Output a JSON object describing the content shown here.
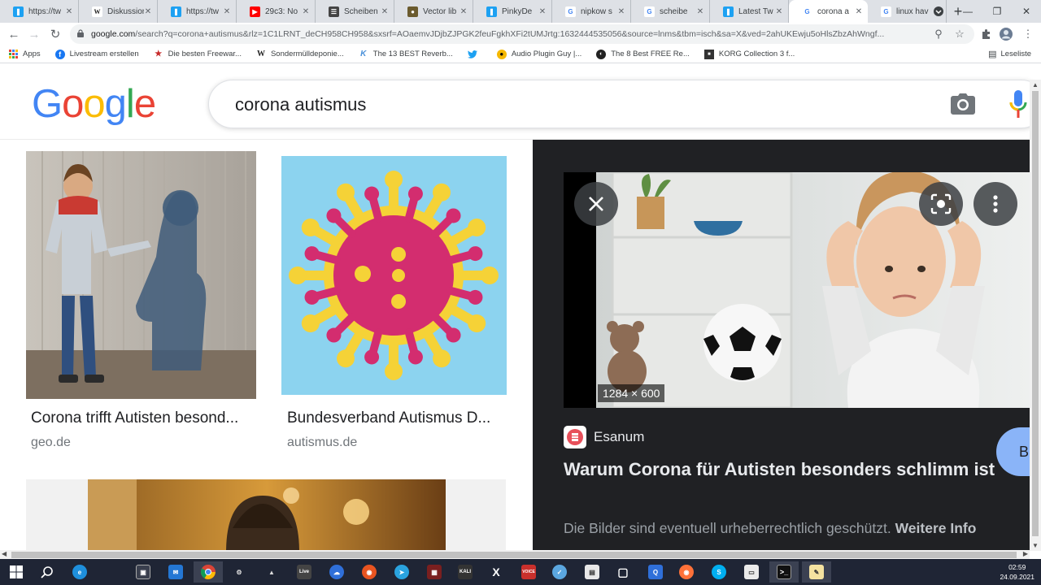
{
  "tabs": [
    {
      "title": "https://tw",
      "icon": "twitter-icon",
      "color": "#1da1f2"
    },
    {
      "title": "Diskussion",
      "icon": "wikipedia-icon",
      "color": "#ffffff"
    },
    {
      "title": "https://tw",
      "icon": "twitter-icon",
      "color": "#1da1f2"
    },
    {
      "title": "29c3: No",
      "icon": "youtube-icon",
      "color": "#ff0000"
    },
    {
      "title": "Scheiben",
      "icon": "page-icon",
      "color": "#444444"
    },
    {
      "title": "Vector lib",
      "icon": "site-icon",
      "color": "#6b5b2e"
    },
    {
      "title": "PinkyDe",
      "icon": "twitter-icon",
      "color": "#1da1f2"
    },
    {
      "title": "nipkow s",
      "icon": "google-icon",
      "color": "#4285f4"
    },
    {
      "title": "scheibe",
      "icon": "google-icon",
      "color": "#4285f4"
    },
    {
      "title": "Latest Tw",
      "icon": "twitter-icon",
      "color": "#1da1f2"
    },
    {
      "title": "corona a",
      "icon": "google-icon",
      "color": "#4285f4",
      "active": true
    },
    {
      "title": "linux hav",
      "icon": "google-icon",
      "color": "#4285f4"
    }
  ],
  "url": {
    "domain": "google.com",
    "rest": "/search?q=corona+autismus&rlz=1C1LRNT_deCH958CH958&sxsrf=AOaemvJDjbZJPGK2feuFgkhXFi2tUMJrtg:1632444535056&source=lnms&tbm=isch&sa=X&ved=2ahUKEwju5oHlsZbzAhWngf..."
  },
  "bookmarks": [
    {
      "label": "Apps"
    },
    {
      "label": "Livestream erstellen"
    },
    {
      "label": "Die besten Freewar..."
    },
    {
      "label": "Sondermülldeponie..."
    },
    {
      "label": "The 13 BEST Reverb..."
    },
    {
      "label": ""
    },
    {
      "label": "Audio Plugin Guy |..."
    },
    {
      "label": "The 8 Best FREE Re..."
    },
    {
      "label": "KORG Collection 3 f..."
    }
  ],
  "reading_list": "Leseliste",
  "search": {
    "query": "corona autismus"
  },
  "logo": [
    "G",
    "o",
    "o",
    "g",
    "l",
    "e"
  ],
  "results": [
    {
      "title": "Corona trifft Autisten besond...",
      "site": "geo.de"
    },
    {
      "title": "Bundesverband Autismus D...",
      "site": "autismus.de"
    }
  ],
  "preview": {
    "dimensions": "1284 × 600",
    "source": "Esanum",
    "title": "Warum Corona für Autisten besonders schlimm ist",
    "copyright_text": "Die Bilder sind eventuell urheberrechtlich geschützt.",
    "copyright_link": "Weitere Info",
    "visit_label": "B"
  },
  "clock": {
    "time": "02:59",
    "date": "24.09.2021"
  },
  "colors": {
    "google_blue": "#4285f4",
    "google_red": "#ea4335",
    "google_yellow": "#fbbc05",
    "google_green": "#34a853",
    "preview_bg": "#202124",
    "taskbar_bg": "#1f2535"
  }
}
